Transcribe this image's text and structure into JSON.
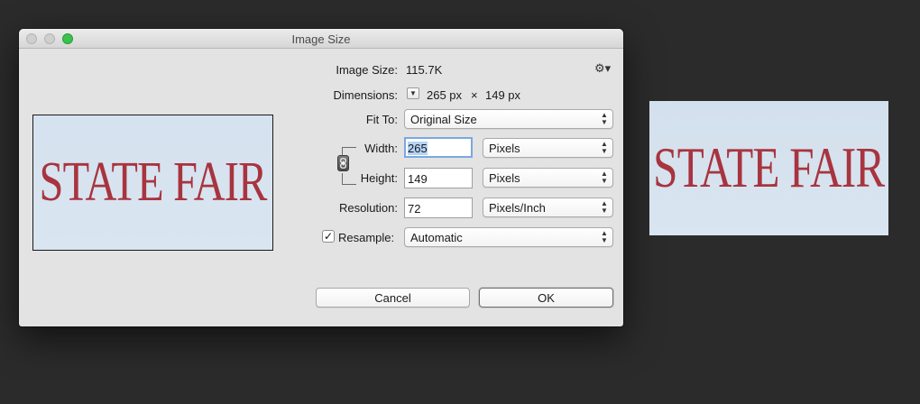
{
  "dialog": {
    "title": "Image Size",
    "preview": {
      "text": "STATE FAIR"
    },
    "image_size": {
      "label": "Image Size:",
      "value": "115.7K"
    },
    "dimensions": {
      "label": "Dimensions:",
      "width": "265 px",
      "times": "×",
      "height": "149 px"
    },
    "fit_to": {
      "label": "Fit To:",
      "value": "Original Size"
    },
    "width": {
      "label": "Width:",
      "value": "265",
      "unit": "Pixels"
    },
    "height": {
      "label": "Height:",
      "value": "149",
      "unit": "Pixels"
    },
    "resolution": {
      "label": "Resolution:",
      "value": "72",
      "unit": "Pixels/Inch"
    },
    "resample": {
      "label": "Resample:",
      "checked": true,
      "check_mark": "✓",
      "value": "Automatic"
    },
    "buttons": {
      "cancel": "Cancel",
      "ok": "OK"
    }
  },
  "canvas_image": {
    "text": "STATE FAIR"
  },
  "icons": {
    "gear": "⚙▾",
    "select_arrows": "▲▼",
    "disclosure": "▼",
    "link": "🔗"
  },
  "colors": {
    "accent_zoom": "#3bc24b",
    "brand_red": "#a8343f",
    "preview_bg": "#d5e2ef",
    "focus_ring": "#7aa8df"
  }
}
